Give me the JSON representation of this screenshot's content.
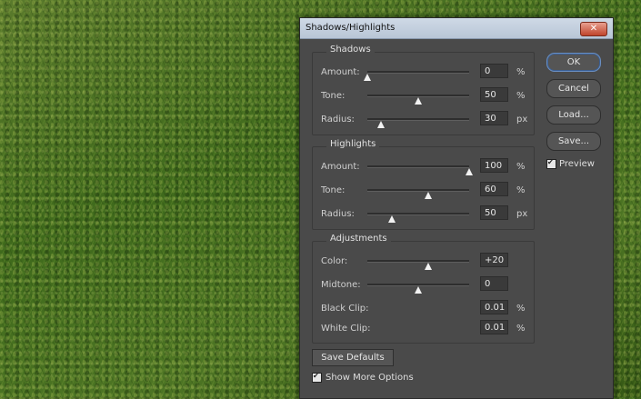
{
  "dialog": {
    "title": "Shadows/Highlights",
    "close_glyph": "✕"
  },
  "shadows": {
    "title": "Shadows",
    "rows": [
      {
        "label": "Amount:",
        "value": "0",
        "unit": "%",
        "slider": 0.0
      },
      {
        "label": "Tone:",
        "value": "50",
        "unit": "%",
        "slider": 0.5
      },
      {
        "label": "Radius:",
        "value": "30",
        "unit": "px",
        "slider": 0.13
      }
    ]
  },
  "highlights": {
    "title": "Highlights",
    "rows": [
      {
        "label": "Amount:",
        "value": "100",
        "unit": "%",
        "slider": 1.0
      },
      {
        "label": "Tone:",
        "value": "60",
        "unit": "%",
        "slider": 0.6
      },
      {
        "label": "Radius:",
        "value": "50",
        "unit": "px",
        "slider": 0.24
      }
    ]
  },
  "adjustments": {
    "title": "Adjustments",
    "rows": [
      {
        "label": "Color:",
        "value": "+20",
        "unit": "",
        "slider": 0.6
      },
      {
        "label": "Midtone:",
        "value": "0",
        "unit": "",
        "slider": 0.5
      },
      {
        "label": "Black Clip:",
        "value": "0.01",
        "unit": "%"
      },
      {
        "label": "White Clip:",
        "value": "0.01",
        "unit": "%"
      }
    ]
  },
  "buttons": {
    "ok": "OK",
    "cancel": "Cancel",
    "load": "Load...",
    "save": "Save...",
    "save_defaults": "Save Defaults"
  },
  "checkboxes": {
    "preview": {
      "label": "Preview",
      "checked": true
    },
    "show_more": {
      "label": "Show More Options",
      "checked": true
    }
  }
}
